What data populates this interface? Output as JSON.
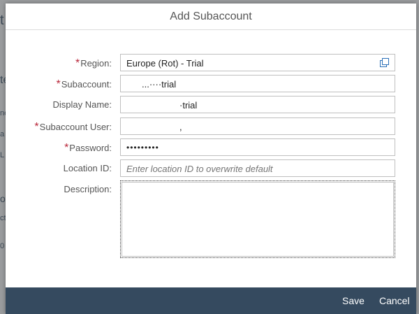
{
  "background": {
    "fragments": [
      "t",
      "te",
      "ne",
      "a",
      "L",
      "o",
      "ct",
      "0"
    ]
  },
  "dialog": {
    "title": "Add Subaccount",
    "fields": {
      "region": {
        "label": "Region:",
        "required": "*",
        "value": "Europe (Rot) - Trial"
      },
      "subaccount": {
        "label": "Subaccount:",
        "required": "*",
        "value": "...····trial"
      },
      "display_name": {
        "label": "Display Name:",
        "value": "·trial"
      },
      "subaccount_user": {
        "label": "Subaccount User:",
        "required": "*",
        "value": ","
      },
      "password": {
        "label": "Password:",
        "required": "*",
        "value": "•••••••••"
      },
      "location_id": {
        "label": "Location ID:",
        "value": "",
        "placeholder": "Enter location ID to overwrite default"
      },
      "description": {
        "label": "Description:",
        "value": ""
      }
    },
    "footer": {
      "save_label": "Save",
      "cancel_label": "Cancel",
      "background_color": "#354a5f"
    }
  },
  "icons": {
    "region_value_help": "value-help-icon"
  }
}
